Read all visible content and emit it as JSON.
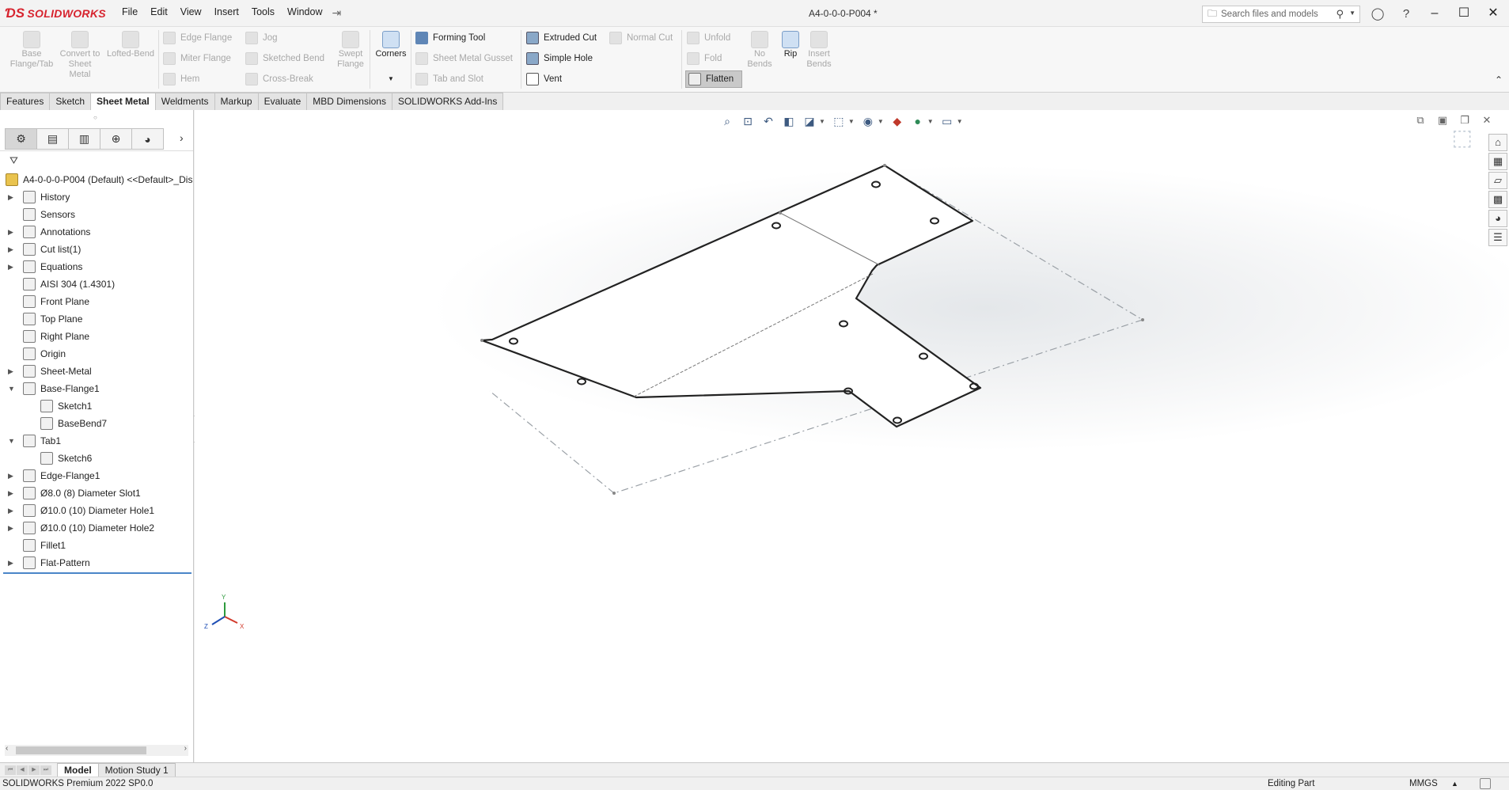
{
  "app": {
    "brand": "SOLIDWORKS",
    "menu": [
      "File",
      "Edit",
      "View",
      "Insert",
      "Tools",
      "Window"
    ],
    "document_title": "A4-0-0-0-P004 *",
    "search_placeholder": "Search files and models"
  },
  "ribbon": {
    "base_flange": "Base Flange/Tab",
    "convert_to_sheet_metal": "Convert to Sheet Metal",
    "lofted_bend": "Lofted-Bend",
    "edge_flange": "Edge Flange",
    "jog": "Jog",
    "miter_flange": "Miter Flange",
    "sketched_bend": "Sketched Bend",
    "hem": "Hem",
    "cross_break": "Cross-Break",
    "swept_flange": "Swept Flange",
    "corners": "Corners",
    "forming_tool": "Forming Tool",
    "sheet_metal_gusset": "Sheet Metal Gusset",
    "tab_and_slot": "Tab and Slot",
    "extruded_cut": "Extruded Cut",
    "normal_cut": "Normal Cut",
    "simple_hole": "Simple Hole",
    "vent": "Vent",
    "unfold": "Unfold",
    "fold": "Fold",
    "no_bends": "No Bends",
    "flatten": "Flatten",
    "rip": "Rip",
    "insert_bends": "Insert Bends"
  },
  "command_tabs": [
    "Features",
    "Sketch",
    "Sheet Metal",
    "Weldments",
    "Markup",
    "Evaluate",
    "MBD Dimensions",
    "SOLIDWORKS Add-Ins"
  ],
  "active_command_tab": "Sheet Metal",
  "tree": {
    "root": "A4-0-0-0-P004 (Default) <<Default>_Dis",
    "items": [
      {
        "label": "History",
        "expand": true,
        "level": 0,
        "icon": "history-icon"
      },
      {
        "label": "Sensors",
        "expand": false,
        "level": 0,
        "icon": "sensors-icon"
      },
      {
        "label": "Annotations",
        "expand": true,
        "level": 0,
        "icon": "annotations-icon"
      },
      {
        "label": "Cut list(1)",
        "expand": true,
        "level": 0,
        "icon": "cut-list-icon"
      },
      {
        "label": "Equations",
        "expand": true,
        "level": 0,
        "icon": "equations-icon"
      },
      {
        "label": "AISI 304 (1.4301)",
        "expand": false,
        "level": 0,
        "icon": "material-icon"
      },
      {
        "label": "Front Plane",
        "expand": false,
        "level": 0,
        "icon": "plane-icon"
      },
      {
        "label": "Top Plane",
        "expand": false,
        "level": 0,
        "icon": "plane-icon"
      },
      {
        "label": "Right Plane",
        "expand": false,
        "level": 0,
        "icon": "plane-icon"
      },
      {
        "label": "Origin",
        "expand": false,
        "level": 0,
        "icon": "origin-icon"
      },
      {
        "label": "Sheet-Metal",
        "expand": true,
        "level": 0,
        "icon": "sheet-metal-icon"
      },
      {
        "label": "Base-Flange1",
        "expand": "open",
        "level": 0,
        "icon": "base-flange-icon"
      },
      {
        "label": "Sketch1",
        "expand": false,
        "level": 1,
        "icon": "sketch-icon"
      },
      {
        "label": "BaseBend7",
        "expand": false,
        "level": 1,
        "icon": "bend-icon"
      },
      {
        "label": "Tab1",
        "expand": "open",
        "level": 0,
        "icon": "tab-icon"
      },
      {
        "label": "Sketch6",
        "expand": false,
        "level": 1,
        "icon": "sketch-icon"
      },
      {
        "label": "Edge-Flange1",
        "expand": true,
        "level": 0,
        "icon": "edge-flange-icon"
      },
      {
        "label": "Ø8.0 (8) Diameter Slot1",
        "expand": true,
        "level": 0,
        "icon": "hole-icon"
      },
      {
        "label": "Ø10.0 (10) Diameter Hole1",
        "expand": true,
        "level": 0,
        "icon": "hole-icon"
      },
      {
        "label": "Ø10.0 (10) Diameter Hole2",
        "expand": true,
        "level": 0,
        "icon": "hole-icon"
      },
      {
        "label": "Fillet1",
        "expand": false,
        "level": 0,
        "icon": "fillet-icon"
      },
      {
        "label": "Flat-Pattern",
        "expand": true,
        "level": 0,
        "icon": "flat-pattern-icon"
      }
    ]
  },
  "triad": {
    "x": "X",
    "y": "Y",
    "z": "Z"
  },
  "bottom_tabs": [
    "Model",
    "Motion Study 1"
  ],
  "status": {
    "product": "SOLIDWORKS Premium 2022 SP0.0",
    "mode": "Editing Part",
    "units": "MMGS"
  }
}
